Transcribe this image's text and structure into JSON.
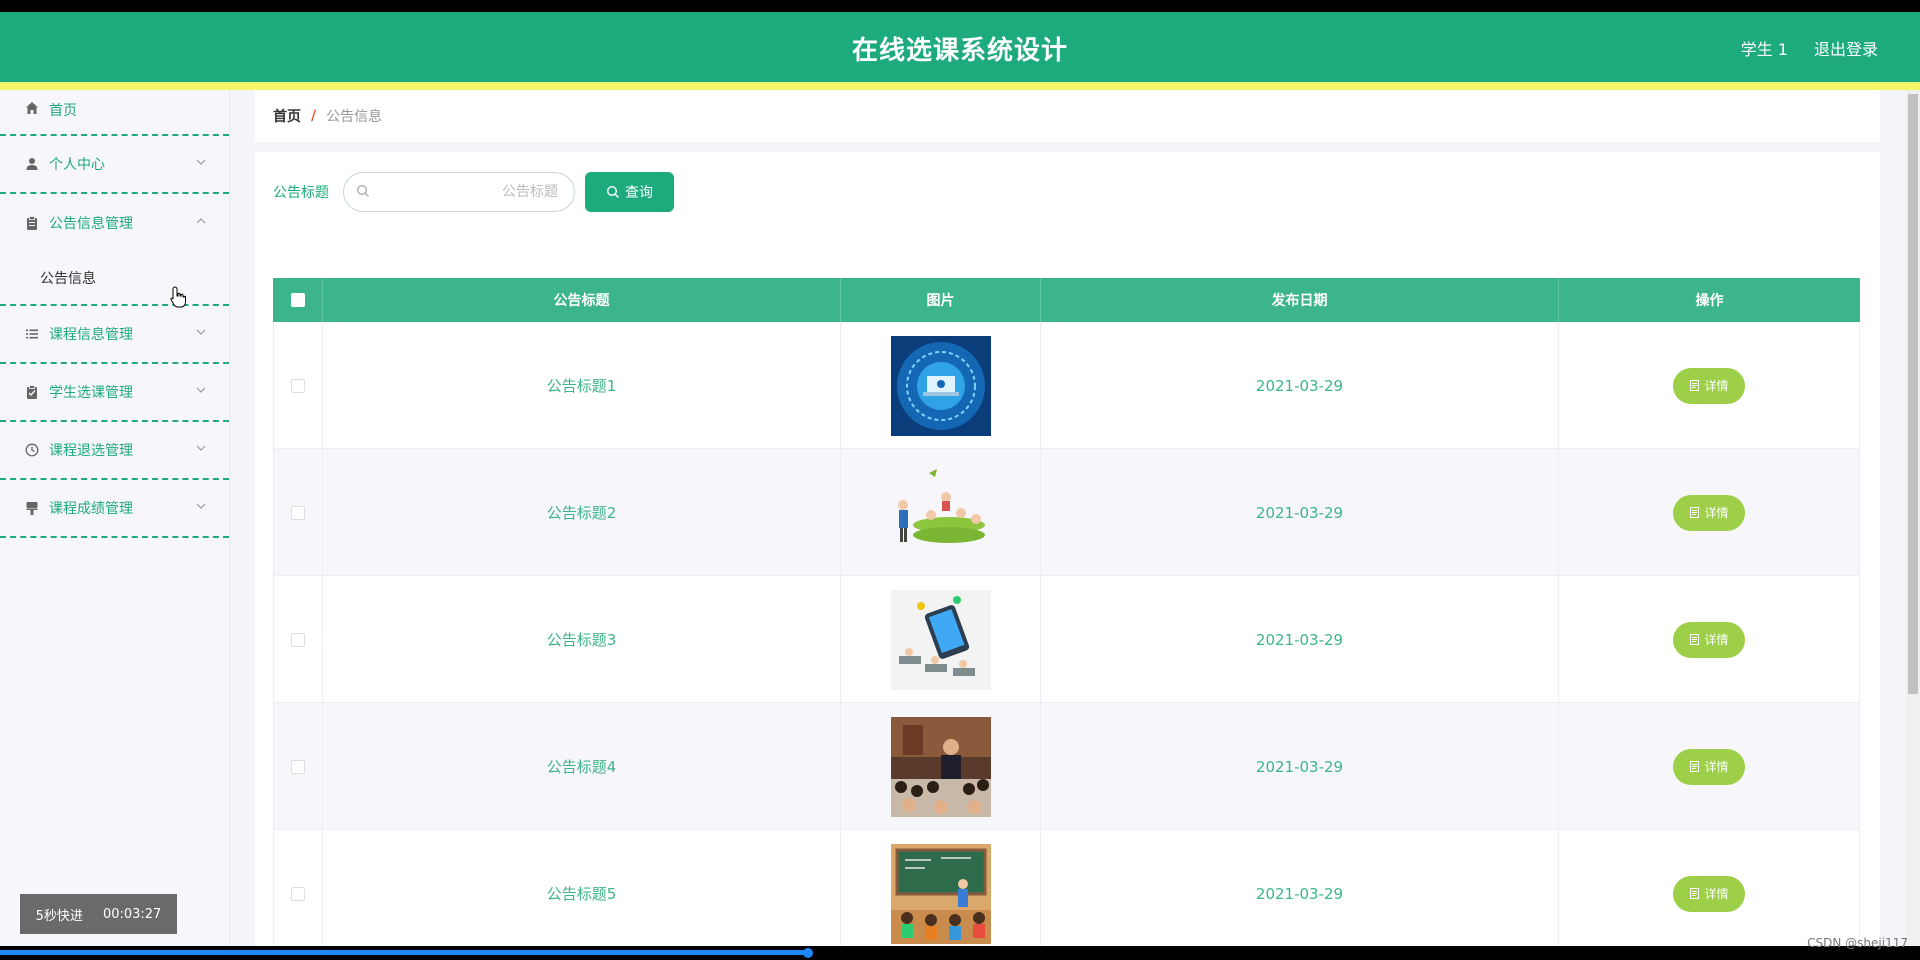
{
  "header": {
    "title": "在线选课系统设计",
    "user": "学生 1",
    "logout": "退出登录",
    "bg_color": "#1daa7c",
    "strip_color": "#f5f76a"
  },
  "sidebar": {
    "items": [
      {
        "label": "首页",
        "icon": "home-icon"
      },
      {
        "label": "个人中心",
        "icon": "user-icon"
      },
      {
        "label": "公告信息管理",
        "icon": "clipboard-icon",
        "expanded": true,
        "sub": "公告信息"
      },
      {
        "label": "课程信息管理",
        "icon": "list-icon"
      },
      {
        "label": "学生选课管理",
        "icon": "clipboard-check-icon"
      },
      {
        "label": "课程退选管理",
        "icon": "clock-icon"
      },
      {
        "label": "课程成绩管理",
        "icon": "brush-icon"
      }
    ]
  },
  "breadcrumb": {
    "home": "首页",
    "separator": "/",
    "current": "公告信息"
  },
  "search": {
    "label": "公告标题",
    "placeholder": "公告标题",
    "button": "查询"
  },
  "table": {
    "headers": [
      "公告标题",
      "图片",
      "发布日期",
      "操作"
    ],
    "rows": [
      {
        "title": "公告标题1",
        "date": "2021-03-29",
        "action": "详情",
        "image": "technology-laptop-image"
      },
      {
        "title": "公告标题2",
        "date": "2021-03-29",
        "action": "详情",
        "image": "classroom-cartoon-image"
      },
      {
        "title": "公告标题3",
        "date": "2021-03-29",
        "action": "详情",
        "image": "online-class-cartoon-image"
      },
      {
        "title": "公告标题4",
        "date": "2021-03-29",
        "action": "详情",
        "image": "lecture-audience-photo"
      },
      {
        "title": "公告标题5",
        "date": "2021-03-29",
        "action": "详情",
        "image": "book-report-classroom-image"
      }
    ]
  },
  "overlay": {
    "fast_forward": "5秒快进",
    "time": "00:03:27",
    "watermark": "CSDN @sheji117"
  }
}
